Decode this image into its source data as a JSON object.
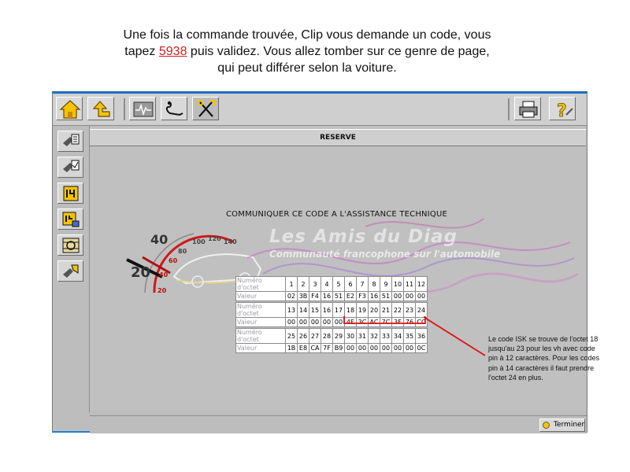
{
  "caption": {
    "line1": "Une fois la commande trouvée, Clip vous demande un code, vous",
    "line2_before": "tapez ",
    "line2_code": "5938",
    "line2_after": " puis validez. Vous allez tomber sur ce genre de page,",
    "line3": "qui peut différer selon la voiture."
  },
  "toolbar": {
    "icons": [
      "home-icon",
      "back-arrow-icon",
      "measure-signal-icon",
      "diagnostic-probe-icon",
      "tools-icon",
      "printer-icon",
      "help-icon"
    ],
    "help_label": "?"
  },
  "sidebar": {
    "icons": [
      "ecu-search-icon",
      "ecu-check-icon",
      "connector-icon",
      "connector-lock-icon",
      "reset-icon",
      "component-icon"
    ]
  },
  "main": {
    "header": "RESERVE",
    "communicate_label": "COMMUNIQUER CE CODE A L'ASSISTANCE TECHNIQUE",
    "gauge_labels": [
      "20",
      "40",
      "60",
      "80",
      "100",
      "120",
      "140",
      "20",
      "40"
    ],
    "watermark_title": "Les Amis du Diag",
    "watermark_subtitle": "Communauté francophone sur l'automobile"
  },
  "octets": {
    "row_label_num": "Numéro d'octet",
    "row_label_val": "Valeur",
    "groups": [
      {
        "numbers": [
          "1",
          "2",
          "3",
          "4",
          "5",
          "6",
          "7",
          "8",
          "9",
          "10",
          "11",
          "12"
        ],
        "values": [
          "02",
          "3B",
          "F4",
          "16",
          "51",
          "E2",
          "F3",
          "16",
          "51",
          "00",
          "00",
          "00"
        ]
      },
      {
        "numbers": [
          "13",
          "14",
          "15",
          "16",
          "17",
          "18",
          "19",
          "20",
          "21",
          "22",
          "23",
          "24"
        ],
        "values": [
          "00",
          "00",
          "00",
          "00",
          "00",
          "4E",
          "3C",
          "AC",
          "7C",
          "3F",
          "76",
          "CC"
        ]
      },
      {
        "numbers": [
          "25",
          "26",
          "27",
          "28",
          "29",
          "30",
          "31",
          "32",
          "33",
          "34",
          "35",
          "36"
        ],
        "values": [
          "1B",
          "E8",
          "CA",
          "7F",
          "B9",
          "00",
          "00",
          "00",
          "00",
          "00",
          "00",
          "0C"
        ]
      }
    ]
  },
  "statusbar": {
    "terminer_label": "Terminer"
  },
  "annotation": {
    "text1": "Le code ISK se trouve de l'octet 18",
    "text2": "jusqu'au 23 pour les vh avec code",
    "text3": "pin à 12 caractères. Pour les codes",
    "text4": "pin à 14 caractères il faut prendre",
    "text5": "l'octet 24 en plus."
  },
  "colors": {
    "title_bar_blue": "#1c6fc0",
    "annotation_red": "#e01010",
    "home_yellow": "#f5c400"
  }
}
